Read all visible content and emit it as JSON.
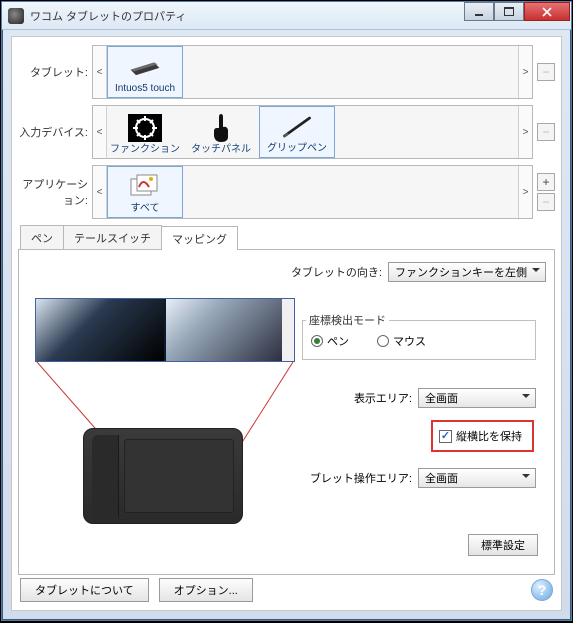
{
  "window": {
    "title": "ワコム タブレットのプロパティ"
  },
  "rows": {
    "tablet_label": "タブレット:",
    "input_label": "入力デバイス:",
    "app_label": "アプリケーション:"
  },
  "tablet_items": [
    {
      "label": "Intuos5 touch",
      "selected": true
    }
  ],
  "input_items": [
    {
      "label": "ファンクション",
      "selected": false
    },
    {
      "label": "タッチパネル",
      "selected": false
    },
    {
      "label": "グリップペン",
      "selected": true
    }
  ],
  "app_items": [
    {
      "label": "すべて",
      "selected": true
    }
  ],
  "tabs": [
    {
      "label": "ペン",
      "active": false
    },
    {
      "label": "テールスイッチ",
      "active": false
    },
    {
      "label": "マッピング",
      "active": true
    }
  ],
  "mapping": {
    "orientation_label": "タブレットの向き:",
    "orientation_value": "ファンクションキーを左側",
    "mode_title": "座標検出モード",
    "mode_pen": "ペン",
    "mode_mouse": "マウス",
    "mode_selected": "pen",
    "display_area_label": "表示エリア:",
    "display_area_value": "全画面",
    "keep_ratio_label": "縦横比を保持",
    "keep_ratio_checked": true,
    "tablet_area_label": "ブレット操作エリア:",
    "tablet_area_value": "全画面",
    "default_button": "標準設定"
  },
  "bottom": {
    "about": "タブレットについて",
    "options": "オプション..."
  }
}
